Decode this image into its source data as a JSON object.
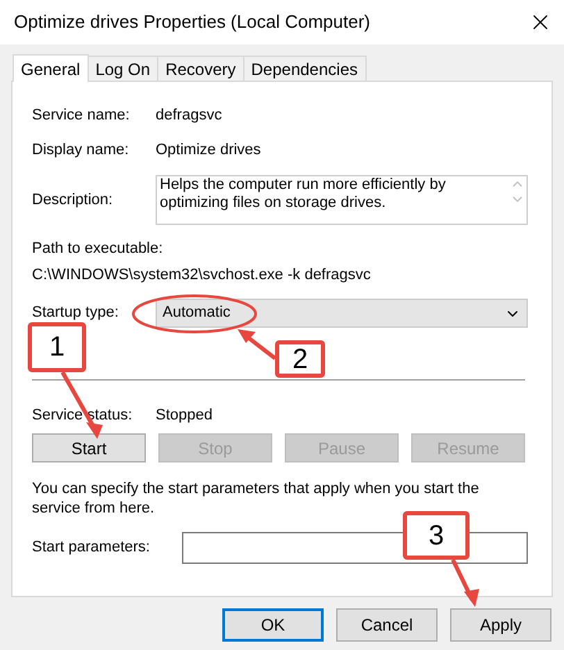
{
  "window": {
    "title": "Optimize drives Properties (Local Computer)"
  },
  "tabs": [
    {
      "label": "General",
      "selected": true
    },
    {
      "label": "Log On",
      "selected": false
    },
    {
      "label": "Recovery",
      "selected": false
    },
    {
      "label": "Dependencies",
      "selected": false
    }
  ],
  "service_name": {
    "label": "Service name:",
    "value": "defragsvc"
  },
  "display_name": {
    "label": "Display name:",
    "value": "Optimize drives"
  },
  "description": {
    "label": "Description:",
    "value": "Helps the computer run more efficiently by optimizing files on storage drives."
  },
  "path": {
    "label": "Path to executable:",
    "value": "C:\\WINDOWS\\system32\\svchost.exe -k defragsvc"
  },
  "startup_type": {
    "label": "Startup type:",
    "value": "Automatic"
  },
  "service_status": {
    "label": "Service status:",
    "value": "Stopped"
  },
  "service_buttons": [
    {
      "label": "Start",
      "disabled": false
    },
    {
      "label": "Stop",
      "disabled": true
    },
    {
      "label": "Pause",
      "disabled": true
    },
    {
      "label": "Resume",
      "disabled": true
    }
  ],
  "hint": "You can specify the start parameters that apply when you start the service from here.",
  "start_parameters": {
    "label": "Start parameters:"
  },
  "dialog_buttons": [
    {
      "label": "OK",
      "default": true
    },
    {
      "label": "Cancel",
      "default": false
    },
    {
      "label": "Apply",
      "default": false
    }
  ],
  "callouts": [
    {
      "label": "1"
    },
    {
      "label": "2"
    },
    {
      "label": "3"
    }
  ]
}
